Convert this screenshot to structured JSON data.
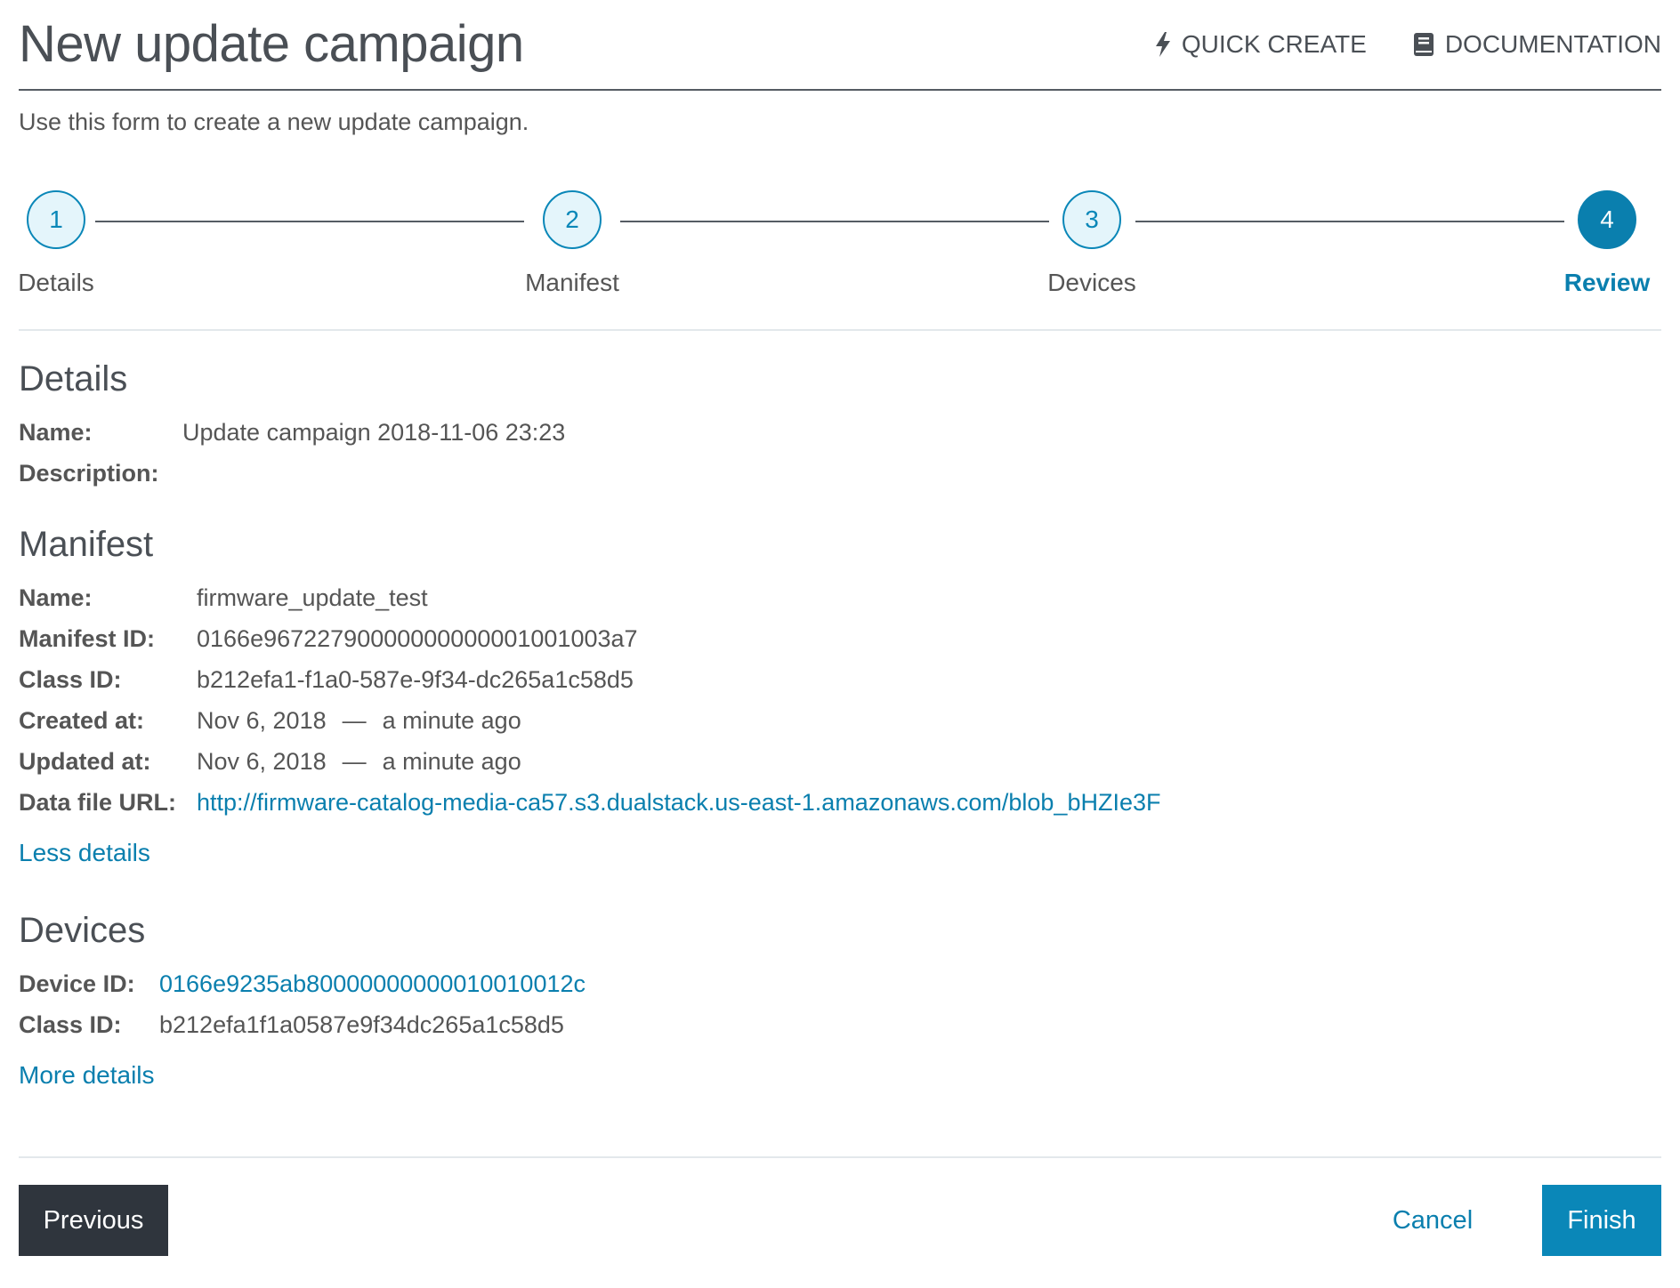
{
  "header": {
    "title": "New update campaign",
    "quick_create": "QUICK CREATE",
    "documentation": "DOCUMENTATION"
  },
  "intro": "Use this form to create a new update campaign.",
  "stepper": {
    "steps": [
      {
        "number": "1",
        "label": "Details"
      },
      {
        "number": "2",
        "label": "Manifest"
      },
      {
        "number": "3",
        "label": "Devices"
      },
      {
        "number": "4",
        "label": "Review"
      }
    ],
    "active_step": 4
  },
  "details": {
    "title": "Details",
    "name_label": "Name:",
    "name_value": "Update campaign 2018-11-06 23:23",
    "description_label": "Description:"
  },
  "manifest": {
    "title": "Manifest",
    "rows": [
      {
        "label": "Name:",
        "value": "firmware_update_test"
      },
      {
        "label": "Manifest ID:",
        "value": "0166e96722790000000000001001003a7"
      },
      {
        "label": "Class ID:",
        "value": "b212efa1-f1a0-587e-9f34-dc265a1c58d5"
      },
      {
        "label": "Created at:",
        "date": "Nov 6, 2018",
        "sep": "—",
        "relative": "a minute ago"
      },
      {
        "label": "Updated at:",
        "date": "Nov 6, 2018",
        "sep": "—",
        "relative": "a minute ago"
      },
      {
        "label": "Data file URL:",
        "value": "http://firmware-catalog-media-ca57.s3.dualstack.us-east-1.amazonaws.com/blob_bHZIe3F"
      }
    ],
    "toggle": "Less details"
  },
  "devices": {
    "title": "Devices",
    "device_id_label": "Device ID:",
    "device_id_value": "0166e9235ab80000000000010010012c",
    "class_id_label": "Class ID:",
    "class_id_value": "b212efa1f1a0587e9f34dc265a1c58d5",
    "toggle": "More details"
  },
  "footer": {
    "previous": "Previous",
    "cancel": "Cancel",
    "finish": "Finish"
  },
  "colors": {
    "accent": "#0a87b8",
    "dark_button": "#2f353d"
  }
}
